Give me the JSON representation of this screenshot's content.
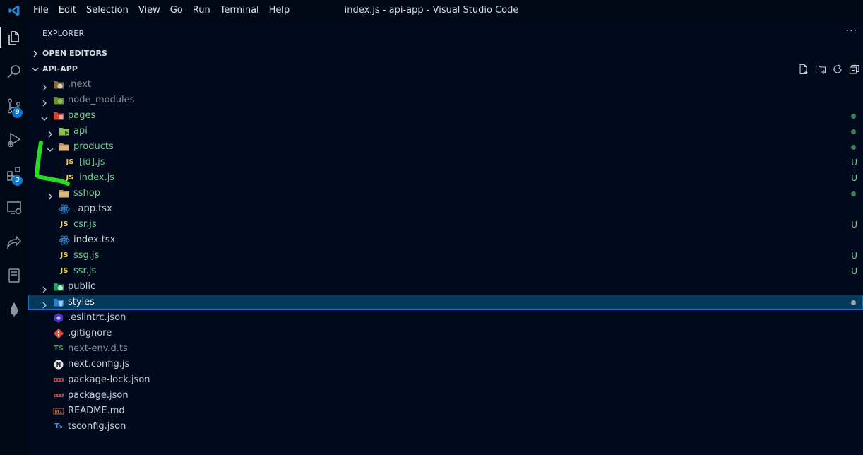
{
  "window": {
    "title": "index.js - api-app - Visual Studio Code"
  },
  "menu": [
    "File",
    "Edit",
    "Selection",
    "View",
    "Go",
    "Run",
    "Terminal",
    "Help"
  ],
  "activity_bar": {
    "items": [
      {
        "icon": "files-icon",
        "badge": ""
      },
      {
        "icon": "search-icon",
        "badge": ""
      },
      {
        "icon": "source-control-icon",
        "badge": "9"
      },
      {
        "icon": "run-debug-icon",
        "badge": ""
      },
      {
        "icon": "extensions-icon",
        "badge": "3"
      },
      {
        "icon": "remote-explorer-icon",
        "badge": ""
      },
      {
        "icon": "live-share-icon",
        "badge": ""
      },
      {
        "icon": "notebook-icon",
        "badge": ""
      },
      {
        "icon": "mongodb-leaf-icon",
        "badge": ""
      }
    ]
  },
  "explorer": {
    "title": "EXPLORER",
    "more": "···",
    "open_editors": "OPEN EDITORS",
    "project": "API-APP",
    "actions": [
      "new-file-icon",
      "new-folder-icon",
      "refresh-icon",
      "collapse-all-icon"
    ],
    "tree": [
      {
        "name": ".next",
        "type": "folder",
        "depth": 0,
        "expanded": false,
        "icon": "next-folder-icon",
        "color": "dim",
        "deco": ""
      },
      {
        "name": "node_modules",
        "type": "folder",
        "depth": 0,
        "expanded": false,
        "icon": "node-folder-icon",
        "color": "dim",
        "deco": ""
      },
      {
        "name": "pages",
        "type": "folder",
        "depth": 0,
        "expanded": true,
        "icon": "pages-folder-icon",
        "color": "green",
        "deco": "dot"
      },
      {
        "name": "api",
        "type": "folder",
        "depth": 1,
        "expanded": false,
        "icon": "api-folder-icon",
        "color": "green",
        "deco": "dot"
      },
      {
        "name": "products",
        "type": "folder",
        "depth": 1,
        "expanded": true,
        "icon": "folder-icon",
        "color": "green",
        "deco": "dot"
      },
      {
        "name": "[id].js",
        "type": "file",
        "depth": 2,
        "icon": "js-icon",
        "color": "green",
        "deco": "U"
      },
      {
        "name": "index.js",
        "type": "file",
        "depth": 2,
        "icon": "js-icon",
        "color": "green",
        "deco": "U"
      },
      {
        "name": "sshop",
        "type": "folder",
        "depth": 1,
        "expanded": false,
        "icon": "folder-icon",
        "color": "green",
        "deco": "dot"
      },
      {
        "name": "_app.tsx",
        "type": "file",
        "depth": 1,
        "icon": "react-icon",
        "color": "light",
        "deco": ""
      },
      {
        "name": "csr.js",
        "type": "file",
        "depth": 1,
        "icon": "js-icon",
        "color": "green",
        "deco": "U"
      },
      {
        "name": "index.tsx",
        "type": "file",
        "depth": 1,
        "icon": "react-icon",
        "color": "light",
        "deco": ""
      },
      {
        "name": "ssg.js",
        "type": "file",
        "depth": 1,
        "icon": "js-icon",
        "color": "green",
        "deco": "U"
      },
      {
        "name": "ssr.js",
        "type": "file",
        "depth": 1,
        "icon": "js-icon",
        "color": "green",
        "deco": "U"
      },
      {
        "name": "public",
        "type": "folder",
        "depth": 0,
        "expanded": false,
        "icon": "public-folder-icon",
        "color": "light",
        "deco": ""
      },
      {
        "name": "styles",
        "type": "folder",
        "depth": 0,
        "expanded": false,
        "icon": "styles-folder-icon",
        "color": "blue",
        "deco": "dot-gray",
        "selected": true
      },
      {
        "name": ".eslintrc.json",
        "type": "file",
        "depth": 0,
        "icon": "eslint-icon",
        "color": "light",
        "deco": ""
      },
      {
        "name": ".gitignore",
        "type": "file",
        "depth": 0,
        "icon": "git-icon",
        "color": "light",
        "deco": ""
      },
      {
        "name": "next-env.d.ts",
        "type": "file",
        "depth": 0,
        "icon": "ts-icon",
        "color": "dim",
        "deco": ""
      },
      {
        "name": "next.config.js",
        "type": "file",
        "depth": 0,
        "icon": "next-icon",
        "color": "light",
        "deco": ""
      },
      {
        "name": "package-lock.json",
        "type": "file",
        "depth": 0,
        "icon": "npm-icon",
        "color": "light",
        "deco": ""
      },
      {
        "name": "package.json",
        "type": "file",
        "depth": 0,
        "icon": "npm-icon",
        "color": "light",
        "deco": ""
      },
      {
        "name": "README.md",
        "type": "file",
        "depth": 0,
        "icon": "markdown-icon",
        "color": "light",
        "deco": ""
      },
      {
        "name": "tsconfig.json",
        "type": "file",
        "depth": 0,
        "icon": "tsconfig-icon",
        "color": "light",
        "deco": ""
      }
    ]
  },
  "colors": {
    "background": "#010a1c",
    "titlebar": "#000814",
    "git_untracked": "#73c991",
    "selection": "#04395e",
    "badge": "#0b79d0",
    "annotation": "#22e01e"
  }
}
